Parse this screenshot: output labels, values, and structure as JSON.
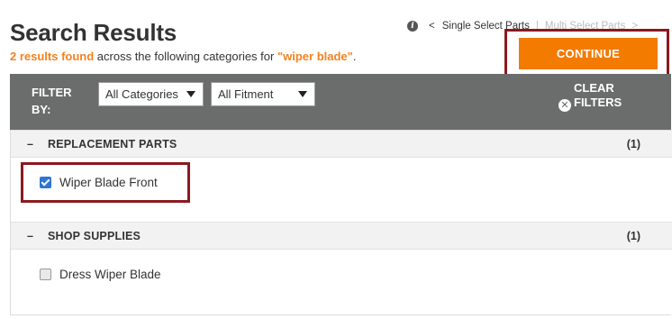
{
  "header": {
    "title": "Search Results",
    "results_count": "2 results found",
    "summary_mid": " across the following categories for ",
    "query": "\"wiper blade\"",
    "summary_end": "."
  },
  "mode_switch": {
    "info_icon": "info-icon",
    "single_label": "Single Select Parts",
    "multi_label": "Multi Select Parts"
  },
  "continue_label": "CONTINUE",
  "filters": {
    "label": "FILTER BY:",
    "category_select": "All Categories",
    "fitment_select": "All Fitment",
    "clear_label": "CLEAR FILTERS"
  },
  "categories": [
    {
      "name": "REPLACEMENT PARTS",
      "count": "(1)",
      "items": [
        {
          "label": "Wiper Blade Front",
          "checked": true
        }
      ]
    },
    {
      "name": "SHOP SUPPLIES",
      "count": "(1)",
      "items": [
        {
          "label": "Dress Wiper Blade",
          "checked": false
        }
      ]
    }
  ],
  "colors": {
    "accent": "#f27b00",
    "highlight_outline": "#8b1a1e",
    "filter_bar": "#6b6d6d",
    "checkbox": "#2f76d2"
  }
}
